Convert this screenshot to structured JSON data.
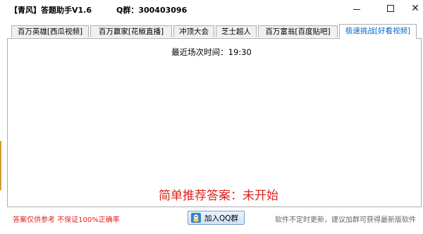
{
  "window": {
    "title": "【青风】答题助手V1.6",
    "qq_group": "Q群：300403096",
    "controls": {
      "minimize": "minimize-icon",
      "maximize": "maximize-icon",
      "close": "close-icon"
    }
  },
  "tabs": [
    {
      "label": "百万英雄[西瓜视频]",
      "active": false
    },
    {
      "label": "百万赢家[花椒直播]",
      "active": false
    },
    {
      "label": "冲顶大会",
      "active": false
    },
    {
      "label": "芝士超人",
      "active": false
    },
    {
      "label": "百万富翁[百度贴吧]",
      "active": false
    },
    {
      "label": "极速挑战[好看视频]",
      "active": true
    }
  ],
  "main": {
    "recent_label": "最近场次时间：",
    "recent_time": "19:30",
    "answer_text": "简单推荐答案：未开始"
  },
  "footer": {
    "warning": "答案仅供参考 不保证100%正确率",
    "qq_button_label": "加入QQ群",
    "note": "软件不定时更新，建议加群可获得最新版软件"
  },
  "colors": {
    "answer_red": "#e0221c",
    "active_tab_blue": "#0066cc"
  }
}
